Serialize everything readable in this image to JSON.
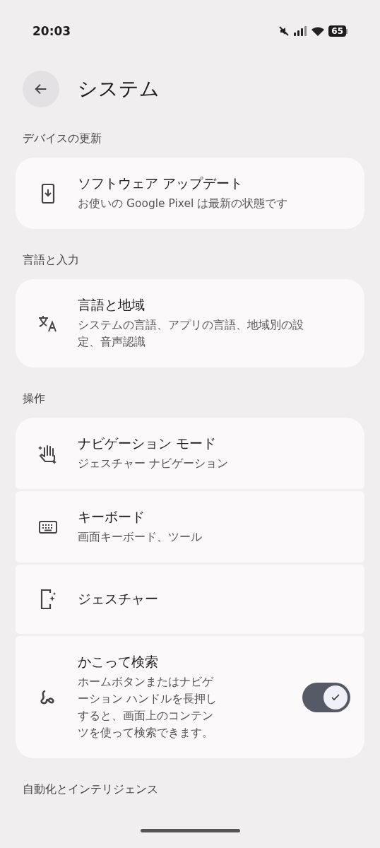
{
  "status_bar": {
    "time": "20:03",
    "battery": "65"
  },
  "header": {
    "title": "システム"
  },
  "sections": [
    {
      "title": "デバイスの更新",
      "items": [
        {
          "kind": "phone-download",
          "title": "ソフトウェア アップデート",
          "subtitle": "お使いの Google Pixel は最新の状態です"
        }
      ]
    },
    {
      "title": "言語と入力",
      "items": [
        {
          "kind": "translate",
          "title": "言語と地域",
          "subtitle": "システムの言語、アプリの言語、地域別の設定、音声認識"
        }
      ]
    },
    {
      "title": "操作",
      "items": [
        {
          "kind": "hand",
          "title": "ナビゲーション モード",
          "subtitle": "ジェスチャー ナビゲーション"
        },
        {
          "kind": "keyboard",
          "title": "キーボード",
          "subtitle": "画面キーボード、ツール"
        },
        {
          "kind": "phone-sparkle",
          "title": "ジェスチャー"
        },
        {
          "kind": "squiggle",
          "title": "かこって検索",
          "subtitle": "ホームボタンまたはナビゲーション ハンドルを長押しすると、画面上のコンテンツを使って検索できます。",
          "toggle": {
            "on": true
          }
        }
      ]
    },
    {
      "title": "自動化とインテリジェンス"
    }
  ]
}
